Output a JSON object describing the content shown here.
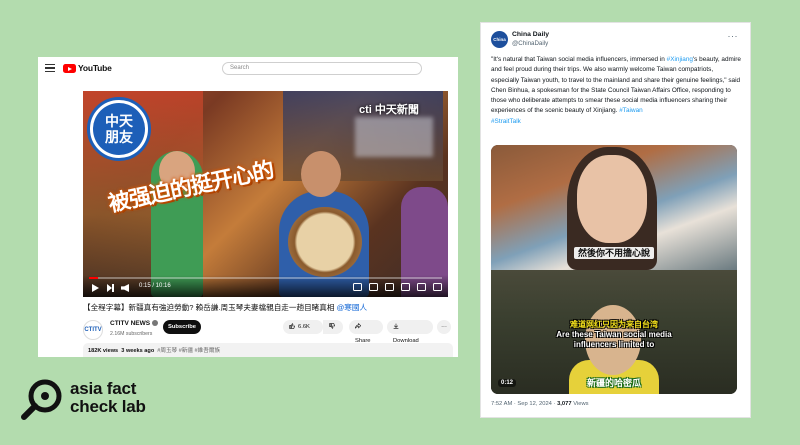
{
  "page": {
    "background": "#b3dcae"
  },
  "youtube": {
    "logo_text": "YouTube",
    "search_placeholder": "Search",
    "video": {
      "badge_line1": "中天",
      "badge_line2": "朋友",
      "channel_watermark": "cti 中天新聞",
      "caption": "被强迫的挺开心的",
      "time": "0:15 / 10:16",
      "progress_fraction": 0.025
    },
    "title_main": "【全程字幕】新疆真有強迫勞動? 賴岳謙.周玉琴夫妻檔親自走一趟目睹真相 ",
    "title_tag": "@寒國人",
    "channel": {
      "logo_text": "CTITV",
      "name": "CTITV NEWS",
      "subscribers": "2.16M subscribers",
      "subscribe_label": "Subscribe"
    },
    "actions": {
      "likes": "6.6K",
      "share": "Share",
      "download": "Download",
      "more": "···"
    },
    "stats": {
      "views": "182K views",
      "age": "3 weeks ago",
      "hashtags": "#周玉琴 #新疆 #維吾爾族"
    }
  },
  "tweet": {
    "avatar_text": "China Daily",
    "name": "China Daily",
    "handle": "@ChinaDaily",
    "more": "···",
    "text_parts": [
      "\"It's natural that Taiwan social media influencers, immersed in ",
      "#Xinjiang",
      "'s beauty, admire and feel proud during their trips. We also warmly welcome Taiwan compatriots, especially Taiwan youth, to travel to the mainland and share their genuine feelings,\" said Chen Binhua, a spokesman for the State Council Taiwan Affairs Office, responding to those who deliberate attempts to smear these social media influencers sharing their experiences of the scenic beauty of Xinjiang. ",
      "#Taiwan",
      "#StraitTalk"
    ],
    "media": {
      "subtitle_top": "然後你不用擔心說",
      "subtitle_mid_line1": "难道网红只因为来自台湾",
      "subtitle_mid_line2": "Are these Taiwan social media",
      "subtitle_mid_line3": "influencers limited to",
      "subtitle_bottom": "新疆的哈密瓜",
      "duration": "0:12"
    },
    "meta_time": "7:52 AM · Sep 12, 2024 · ",
    "meta_views": "3,077",
    "meta_views_label": " Views"
  },
  "brand": {
    "line1": "asia fact",
    "line2": "check lab"
  }
}
